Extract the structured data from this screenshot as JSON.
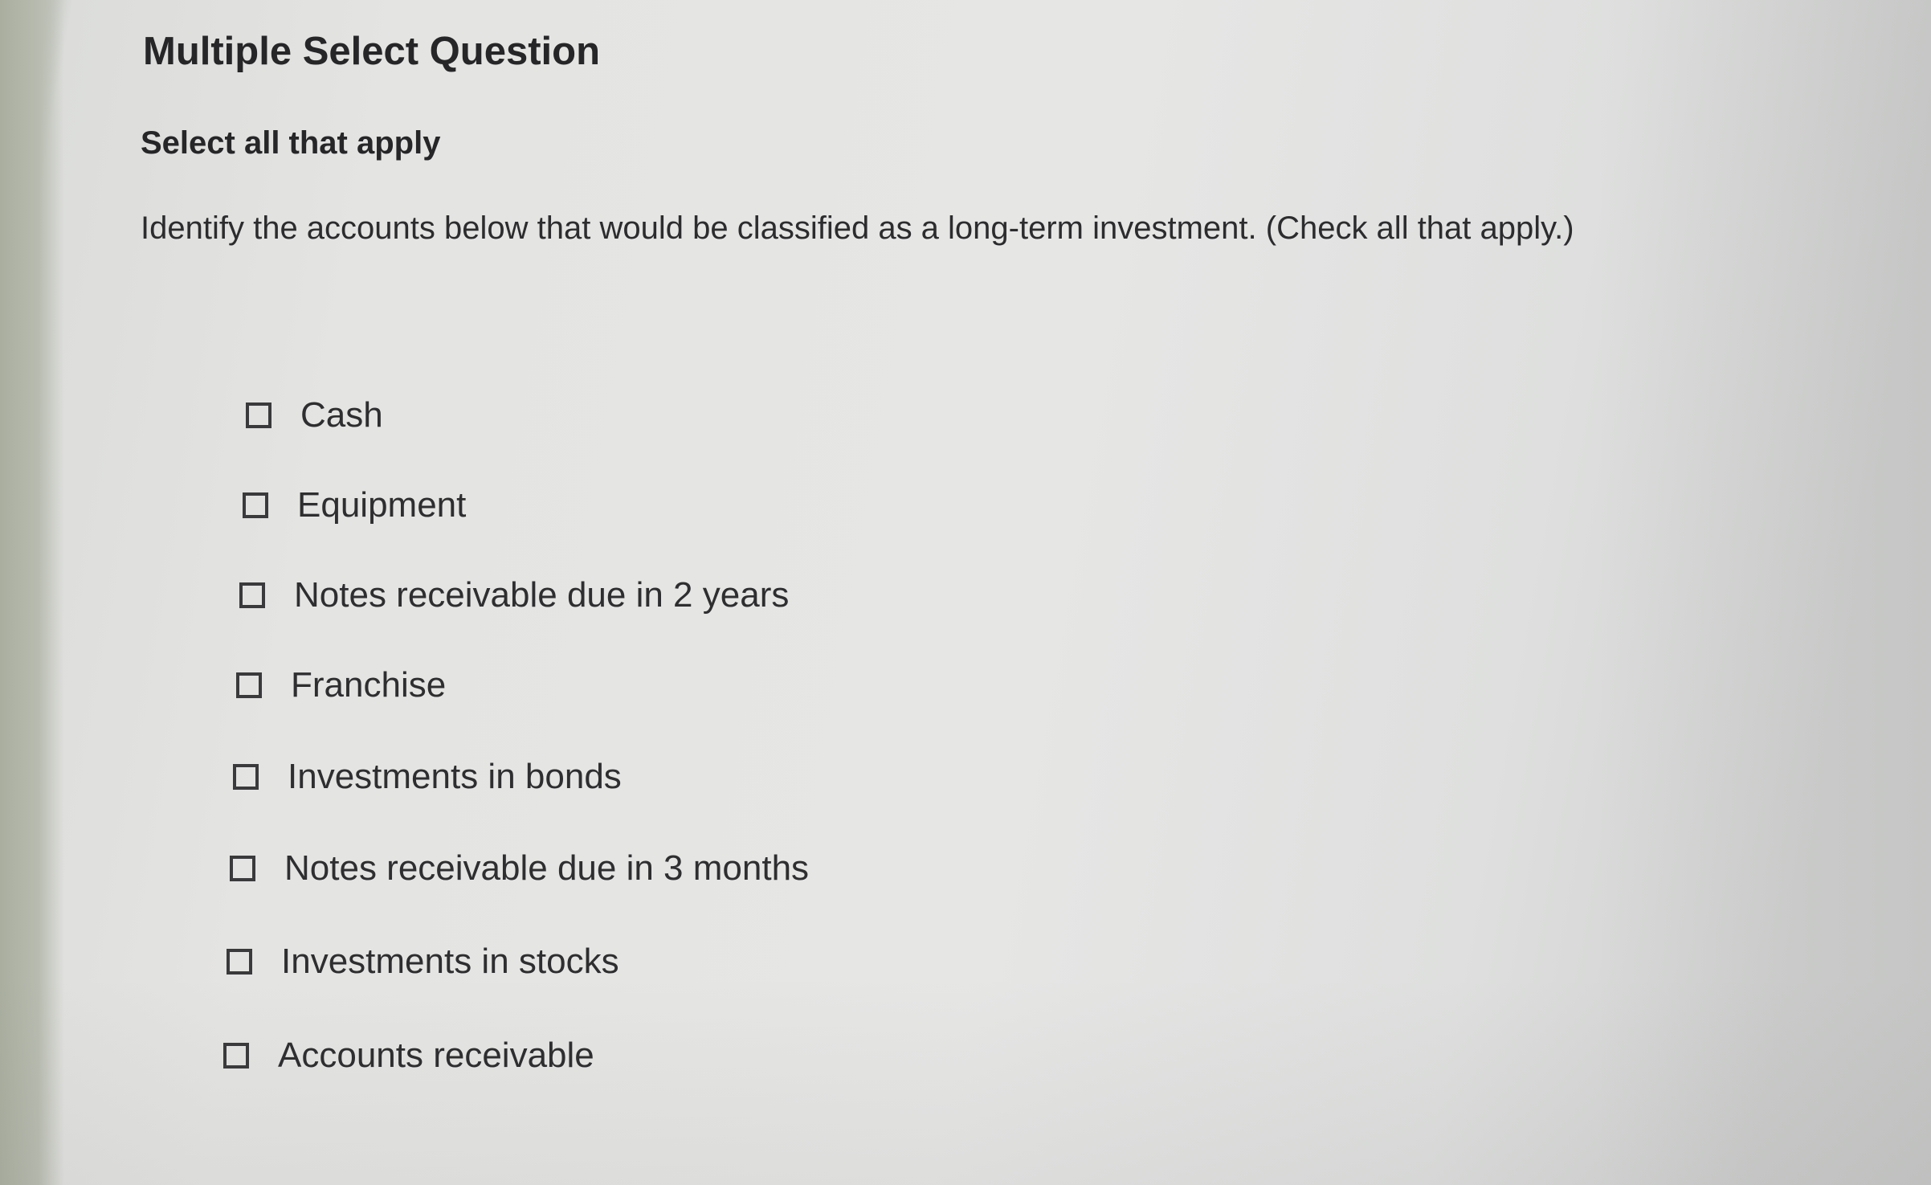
{
  "question": {
    "title": "Multiple Select Question",
    "instruction": "Select all that apply",
    "prompt": "Identify the accounts below that would be classified as a long-term investment. (Check all that apply.)",
    "options": [
      {
        "label": "Cash",
        "checked": false
      },
      {
        "label": "Equipment",
        "checked": false
      },
      {
        "label": "Notes receivable due in 2 years",
        "checked": false
      },
      {
        "label": "Franchise",
        "checked": false
      },
      {
        "label": "Investments in bonds",
        "checked": false
      },
      {
        "label": "Notes receivable due in 3 months",
        "checked": false
      },
      {
        "label": "Investments in stocks",
        "checked": false
      },
      {
        "label": "Accounts receivable",
        "checked": false
      }
    ]
  },
  "colors": {
    "text": "#2a2a2c",
    "checkbox_border": "#3a3a3c",
    "background": "#e4e4e2"
  }
}
